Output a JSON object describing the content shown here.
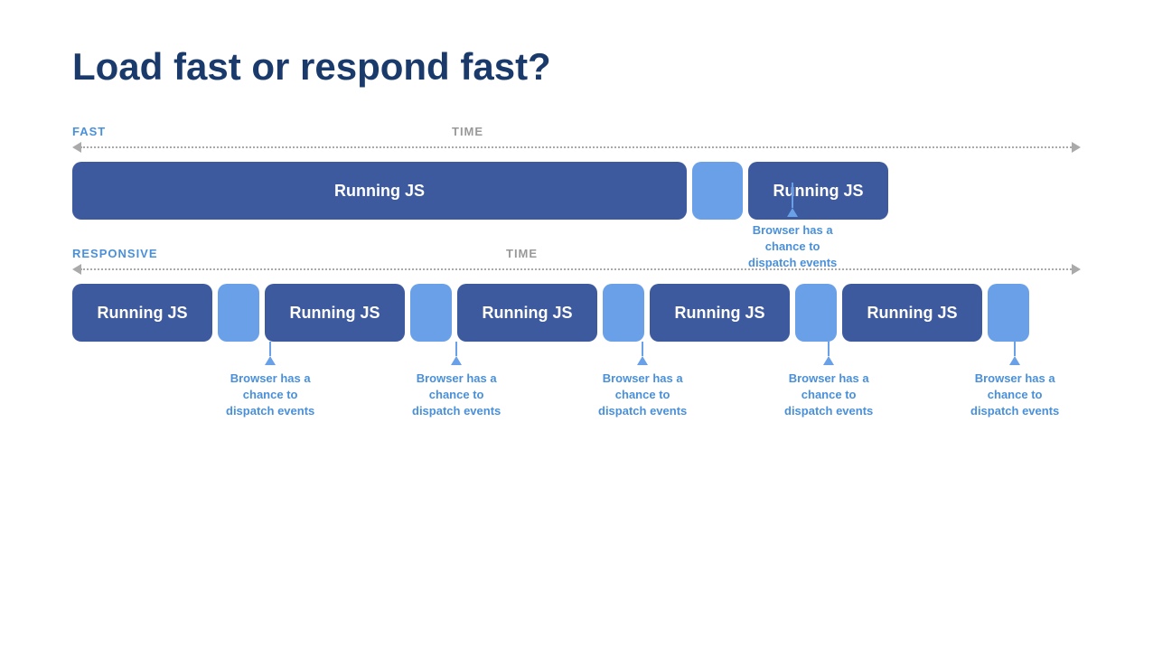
{
  "title": "Load fast or respond fast?",
  "fast_section": {
    "label": "FAST",
    "time_label": "TIME",
    "js_block_large": "Running JS",
    "js_block_small": "Running JS",
    "annotation_text": "Browser has a\nchance to\ndispatch events"
  },
  "responsive_section": {
    "label": "RESPONSIVE",
    "time_label": "TIME",
    "js_blocks": [
      "Running JS",
      "Running JS",
      "Running JS",
      "Running JS",
      "Running JS"
    ],
    "annotation_text": "Browser has a\nchance to\ndispatch events"
  },
  "colors": {
    "title": "#1a3a6b",
    "js_block": "#3d5a9e",
    "gap_block": "#6aa0e8",
    "annotation": "#4a90d9",
    "label": "#4a90d9",
    "time_label": "#999999"
  }
}
